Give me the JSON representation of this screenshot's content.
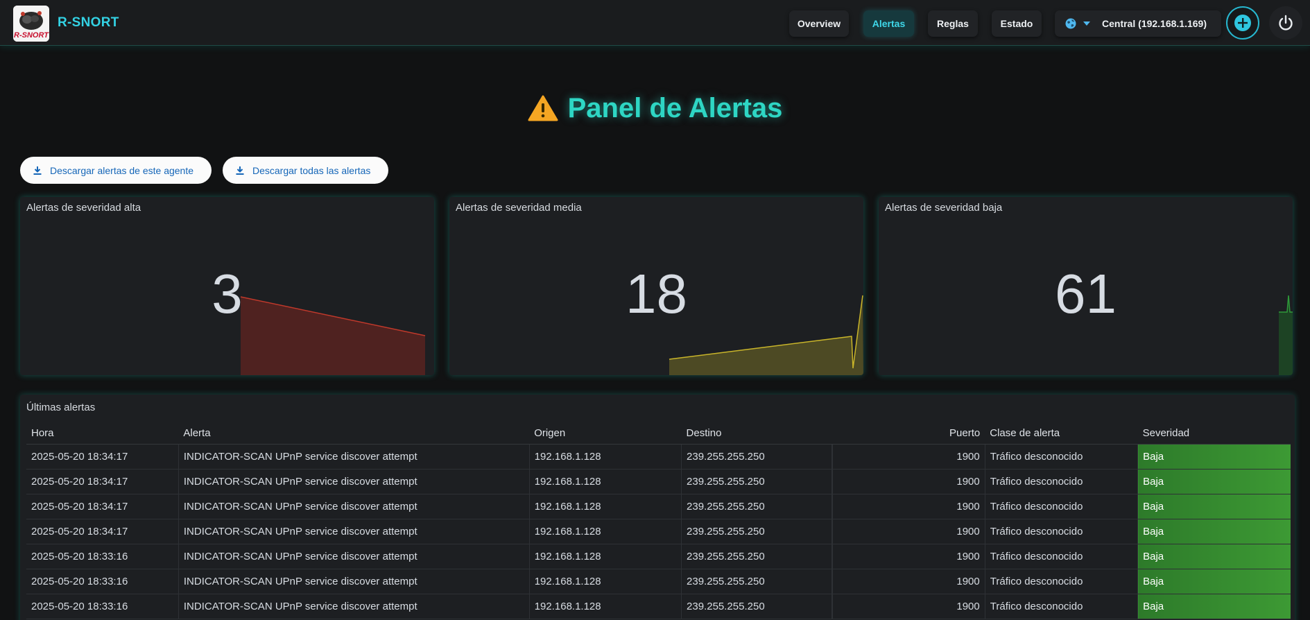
{
  "header": {
    "brand": "R-SNORT",
    "logo_text": "R-SNORT",
    "nav": [
      {
        "label": "Overview",
        "active": false
      },
      {
        "label": "Alertas",
        "active": true
      },
      {
        "label": "Reglas",
        "active": false
      },
      {
        "label": "Estado",
        "active": false
      }
    ],
    "agent_label": "Central (192.168.1.169)",
    "icons": {
      "agent": "globe-icon",
      "add": "add-circle-icon",
      "power": "power-icon"
    },
    "accent": "#33d2e4"
  },
  "page": {
    "title": "Panel de Alertas",
    "title_icon": "warning-icon",
    "title_color": "#2ed6c4"
  },
  "downloads": {
    "agent_label": "Descargar alertas de este agente",
    "all_label": "Descargar todas las alertas"
  },
  "stats": [
    {
      "title": "Alertas de severidad alta",
      "value": "3",
      "color": "#c0392b"
    },
    {
      "title": "Alertas de severidad media",
      "value": "18",
      "color": "#c9b52a"
    },
    {
      "title": "Alertas de severidad baja",
      "value": "61",
      "color": "#2e9a3a"
    }
  ],
  "alerts_table": {
    "title": "Últimas alertas",
    "columns": [
      "Hora",
      "Alerta",
      "Origen",
      "Destino",
      "",
      "Puerto",
      "Clase de alerta",
      "Severidad"
    ],
    "rows": [
      [
        "2025-05-20 18:34:17",
        "INDICATOR-SCAN UPnP service discover attempt",
        "192.168.1.128",
        "239.255.255.250",
        "",
        "1900",
        "Tráfico desconocido",
        "Baja"
      ],
      [
        "2025-05-20 18:34:17",
        "INDICATOR-SCAN UPnP service discover attempt",
        "192.168.1.128",
        "239.255.255.250",
        "",
        "1900",
        "Tráfico desconocido",
        "Baja"
      ],
      [
        "2025-05-20 18:34:17",
        "INDICATOR-SCAN UPnP service discover attempt",
        "192.168.1.128",
        "239.255.255.250",
        "",
        "1900",
        "Tráfico desconocido",
        "Baja"
      ],
      [
        "2025-05-20 18:34:17",
        "INDICATOR-SCAN UPnP service discover attempt",
        "192.168.1.128",
        "239.255.255.250",
        "",
        "1900",
        "Tráfico desconocido",
        "Baja"
      ],
      [
        "2025-05-20 18:33:16",
        "INDICATOR-SCAN UPnP service discover attempt",
        "192.168.1.128",
        "239.255.255.250",
        "",
        "1900",
        "Tráfico desconocido",
        "Baja"
      ],
      [
        "2025-05-20 18:33:16",
        "INDICATOR-SCAN UPnP service discover attempt",
        "192.168.1.128",
        "239.255.255.250",
        "",
        "1900",
        "Tráfico desconocido",
        "Baja"
      ],
      [
        "2025-05-20 18:33:16",
        "INDICATOR-SCAN UPnP service discover attempt",
        "192.168.1.128",
        "239.255.255.250",
        "",
        "1900",
        "Tráfico desconocido",
        "Baja"
      ]
    ],
    "severity_color": "#2d7a2a"
  }
}
